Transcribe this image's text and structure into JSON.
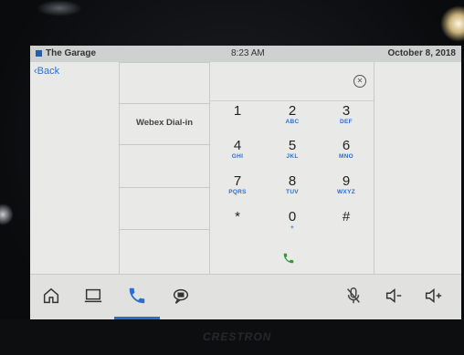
{
  "status_bar": {
    "room_name": "The Garage",
    "time": "8:23 AM",
    "date": "October 8, 2018"
  },
  "nav": {
    "back_label": "Back"
  },
  "dial_options": [
    {
      "label": "Webex Dial-in"
    },
    {
      "label": ""
    },
    {
      "label": ""
    },
    {
      "label": ""
    }
  ],
  "keypad": {
    "keys": [
      {
        "digit": "1",
        "letters": ""
      },
      {
        "digit": "2",
        "letters": "ABC"
      },
      {
        "digit": "3",
        "letters": "DEF"
      },
      {
        "digit": "4",
        "letters": "GHI"
      },
      {
        "digit": "5",
        "letters": "JKL"
      },
      {
        "digit": "6",
        "letters": "MNO"
      },
      {
        "digit": "7",
        "letters": "PQRS"
      },
      {
        "digit": "8",
        "letters": "TUV"
      },
      {
        "digit": "9",
        "letters": "WXYZ"
      },
      {
        "digit": "*",
        "letters": ""
      },
      {
        "digit": "0",
        "letters": "+"
      },
      {
        "digit": "#",
        "letters": ""
      }
    ]
  },
  "bottom_bar": {
    "buttons": [
      "home-icon",
      "laptop-icon",
      "phone-icon",
      "chat-icon",
      "mic-mute-icon",
      "volume-down-icon",
      "volume-up-icon"
    ],
    "active": "phone-icon"
  },
  "brand": "CRESTRON",
  "colors": {
    "accent": "#2a6fd0",
    "call_green": "#2f9a3a",
    "screen_bg": "#e9e9e7"
  }
}
